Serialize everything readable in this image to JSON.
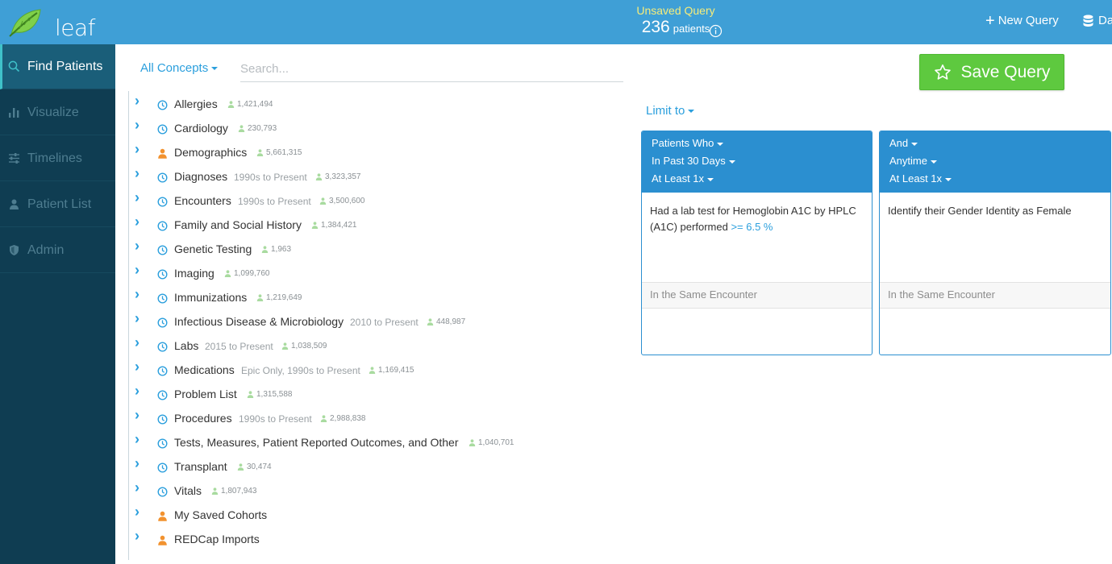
{
  "header": {
    "app_name": "leaf",
    "query_title": "Unsaved Query",
    "patient_count": "236",
    "patient_unit": "patients",
    "new_query_label": "New Query",
    "db_label": "Da"
  },
  "colors": {
    "header_bg": "#3f9fd6",
    "sidebar_bg": "#0f3d52",
    "accent": "#2b9fdd",
    "save_green": "#5ec93f",
    "title_yellow": "#f6ec7a",
    "demographics_orange": "#f2922f"
  },
  "sidebar": {
    "items": [
      {
        "label": "Find Patients",
        "icon": "search-icon",
        "active": true
      },
      {
        "label": "Visualize",
        "icon": "bar-chart-icon",
        "active": false
      },
      {
        "label": "Timelines",
        "icon": "sliders-icon",
        "active": false
      },
      {
        "label": "Patient List",
        "icon": "person-icon",
        "active": false
      },
      {
        "label": "Admin",
        "icon": "shield-icon",
        "active": false
      }
    ]
  },
  "search": {
    "concepts_dropdown": "All Concepts",
    "placeholder": "Search..."
  },
  "tree": {
    "items": [
      {
        "label": "Allergies",
        "extra": "",
        "count": "1,421,494",
        "icon": "clock-icon"
      },
      {
        "label": "Cardiology",
        "extra": "",
        "count": "230,793",
        "icon": "clock-icon"
      },
      {
        "label": "Demographics",
        "extra": "",
        "count": "5,661,315",
        "icon": "person-icon"
      },
      {
        "label": "Diagnoses",
        "extra": "1990s to Present",
        "count": "3,323,357",
        "icon": "clock-icon"
      },
      {
        "label": "Encounters",
        "extra": "1990s to Present",
        "count": "3,500,600",
        "icon": "clock-icon"
      },
      {
        "label": "Family and Social History",
        "extra": "",
        "count": "1,384,421",
        "icon": "clock-icon"
      },
      {
        "label": "Genetic Testing",
        "extra": "",
        "count": "1,963",
        "icon": "clock-icon"
      },
      {
        "label": "Imaging",
        "extra": "",
        "count": "1,099,760",
        "icon": "clock-icon"
      },
      {
        "label": "Immunizations",
        "extra": "",
        "count": "1,219,649",
        "icon": "clock-icon"
      },
      {
        "label": "Infectious Disease & Microbiology",
        "extra": "2010 to Present",
        "count": "448,987",
        "icon": "clock-icon"
      },
      {
        "label": "Labs",
        "extra": "2015 to Present",
        "count": "1,038,509",
        "icon": "clock-icon"
      },
      {
        "label": "Medications",
        "extra": "Epic Only, 1990s to Present",
        "count": "1,169,415",
        "icon": "clock-icon"
      },
      {
        "label": "Problem List",
        "extra": "",
        "count": "1,315,588",
        "icon": "clock-icon"
      },
      {
        "label": "Procedures",
        "extra": "1990s to Present",
        "count": "2,988,838",
        "icon": "clock-icon"
      },
      {
        "label": "Tests, Measures, Patient Reported Outcomes, and Other",
        "extra": "",
        "count": "1,040,701",
        "icon": "clock-icon"
      },
      {
        "label": "Transplant",
        "extra": "",
        "count": "30,474",
        "icon": "clock-icon"
      },
      {
        "label": "Vitals",
        "extra": "",
        "count": "1,807,943",
        "icon": "clock-icon"
      },
      {
        "label": "My Saved Cohorts",
        "extra": "",
        "count": "",
        "icon": "person-icon"
      },
      {
        "label": "REDCap Imports",
        "extra": "",
        "count": "",
        "icon": "person-icon"
      }
    ]
  },
  "save_query_label": "Save Query",
  "limit_to_label": "Limit to",
  "panels": [
    {
      "header": [
        "Patients Who",
        "In Past 30 Days",
        "At Least 1x"
      ],
      "body_text": "Had a lab test for Hemoglobin A1C by HPLC (A1C) performed",
      "body_highlight": ">= 6.5 %",
      "footer": "In the Same Encounter"
    },
    {
      "header": [
        "And",
        "Anytime",
        "At Least 1x"
      ],
      "body_text": "Identify their Gender Identity as Female",
      "body_highlight": "",
      "footer": "In the Same Encounter"
    }
  ]
}
